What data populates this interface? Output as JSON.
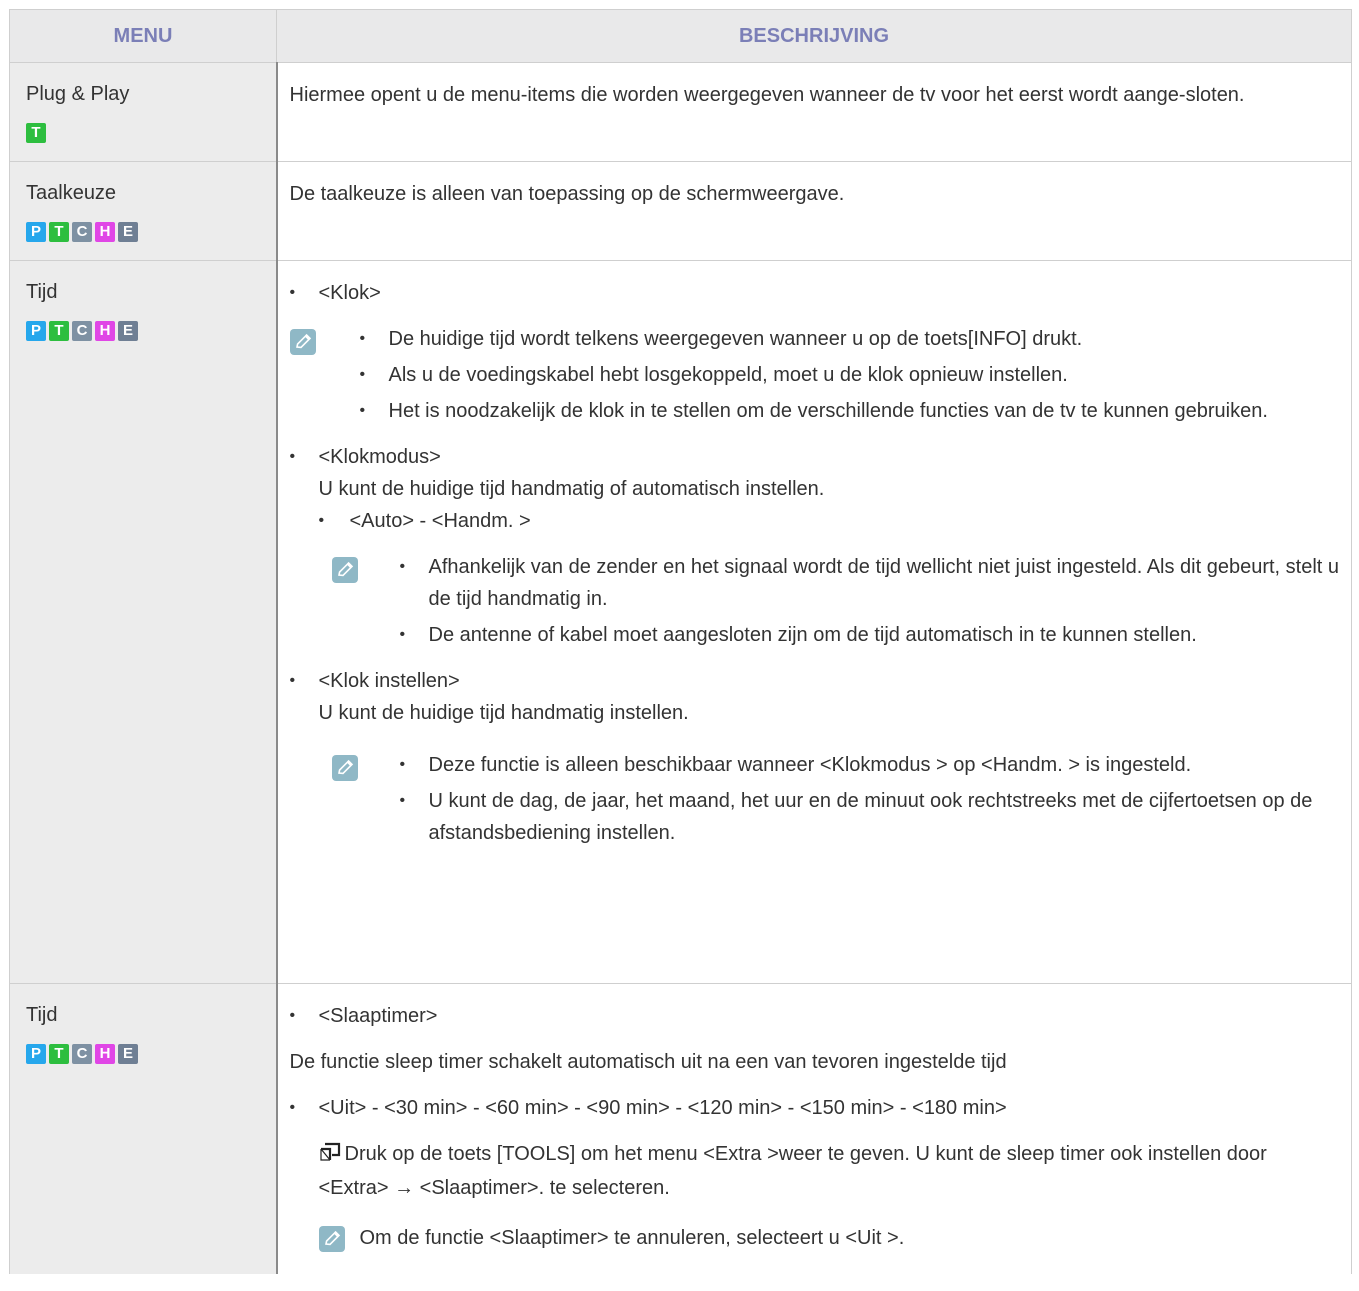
{
  "header": {
    "menu": "MENU",
    "description": "BESCHRIJVING"
  },
  "icons": {
    "note": "note-pencil-icon",
    "tools": "tools-icon"
  },
  "badge_colors": {
    "P": "#26a7ec",
    "T": "#2dbe3f",
    "C": "#7e91a3",
    "H": "#e046e6",
    "E": "#6f7f94"
  },
  "rows": [
    {
      "menu": "Plug & Play",
      "badges": [
        "T"
      ],
      "text": "Hiermee opent u de menu-items die worden weergegeven wanneer de tv voor het eerst wordt aange-sloten."
    },
    {
      "menu": "Taalkeuze",
      "badges": [
        "P",
        "T",
        "C",
        "H",
        "E"
      ],
      "text": "De taalkeuze is alleen van toepassing op de schermweergave."
    },
    {
      "menu": "Tijd",
      "badges": [
        "P",
        "T",
        "C",
        "H",
        "E"
      ],
      "klok": {
        "title": "<Klok>",
        "notes": [
          "De huidige tijd wordt telkens weergegeven wanneer u op de toets[INFO] drukt.",
          "Als u de voedingskabel hebt losgekoppeld, moet u de klok opnieuw instellen.",
          "Het is noodzakelijk de klok in te stellen om de verschillende functies van de tv te kunnen gebruiken."
        ]
      },
      "klokmodus": {
        "title": "<Klokmodus>",
        "desc": "U kunt de huidige tijd handmatig of automatisch instellen.",
        "options": "<Auto> - <Handm. >",
        "notes": [
          "Afhankelijk van de zender en het signaal wordt de tijd wellicht niet juist ingesteld. Als dit gebeurt, stelt u de tijd handmatig in.",
          "De antenne of kabel moet aangesloten zijn om de tijd automatisch in te kunnen stellen."
        ]
      },
      "klok_instellen": {
        "title": "<Klok instellen>",
        "desc": "U kunt de huidige tijd handmatig instellen.",
        "notes": [
          "Deze functie is alleen beschikbaar wanneer <Klokmodus > op <Handm. > is ingesteld.",
          "U kunt de dag, de jaar, het maand, het uur en de minuut ook rechtstreeks met de cijfertoetsen op de afstandsbediening instellen."
        ]
      }
    },
    {
      "menu": "Tijd",
      "badges": [
        "P",
        "T",
        "C",
        "H",
        "E"
      ],
      "slaaptimer": {
        "title": "<Slaaptimer>",
        "desc": "De functie sleep timer schakelt automatisch uit na een van tevoren ingestelde tijd",
        "options": "<Uit> - <30 min> - <60 min> - <90 min> - <120 min> - <150 min> - <180 min>",
        "tools_text": "Druk op de toets [TOOLS] om het menu <Extra >weer te geven. U kunt de sleep timer ook instellen door <Extra> → <Slaaptimer>. te selecteren.",
        "note": "Om de functie <Slaaptimer> te annuleren, selecteert u <Uit >."
      }
    }
  ]
}
